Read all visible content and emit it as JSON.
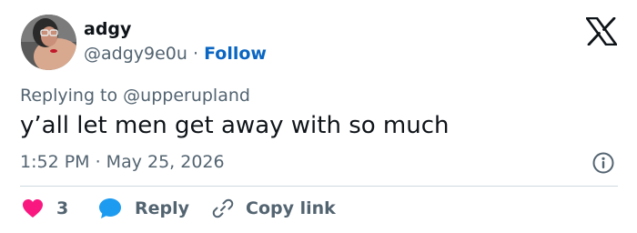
{
  "author": {
    "name": "adgy",
    "handle": "@adgy9e0u",
    "separator": "·",
    "follow_label": "Follow"
  },
  "tweet": {
    "replying_to": "Replying to @upperupland",
    "text": "y’all let men get away with so much",
    "timestamp": "1:52 PM · May 25, 2026"
  },
  "actions": {
    "like_count": "3",
    "reply_label": "Reply",
    "copy_link_label": "Copy link"
  },
  "colors": {
    "like": "#f91880",
    "reply": "#1d9bf0",
    "follow": "#0a66c2",
    "muted": "#536471"
  },
  "icons": [
    "x-logo-icon",
    "info-icon",
    "heart-icon",
    "reply-bubble-icon",
    "link-icon"
  ]
}
